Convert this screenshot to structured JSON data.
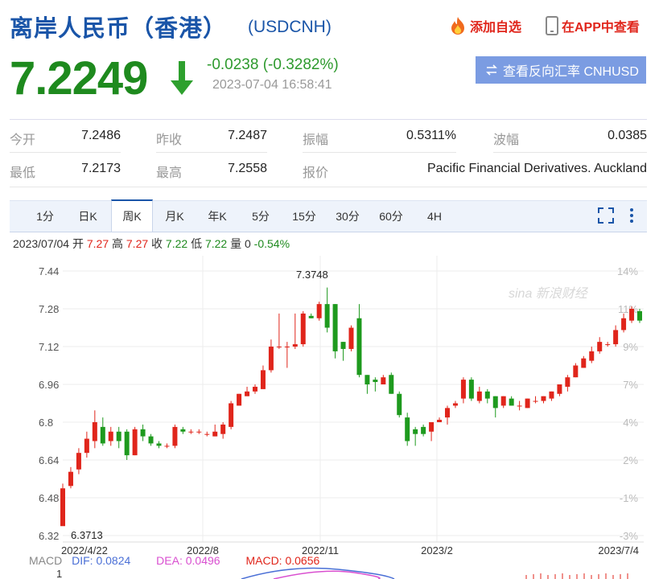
{
  "header": {
    "title": "离岸人民币（香港）",
    "code": "(USDCNH)",
    "add_watchlist": "添加自选",
    "view_in_app": "在APP中查看"
  },
  "quote": {
    "price": "7.2249",
    "change": "-0.0238 (-0.3282%)",
    "time": "2023-07-04 16:58:41",
    "reverse_button": "查看反向汇率 CNHUSD"
  },
  "stats": [
    [
      {
        "label": "今开",
        "value": "7.2486"
      },
      {
        "label": "昨收",
        "value": "7.2487"
      },
      {
        "label": "振幅",
        "value": "0.5311%"
      },
      {
        "label": "波幅",
        "value": "0.0385"
      }
    ],
    [
      {
        "label": "最低",
        "value": "7.2173"
      },
      {
        "label": "最高",
        "value": "7.2558"
      },
      {
        "label": "报价",
        "value": "Pacific Financial Derivatives. Auckland"
      }
    ]
  ],
  "tabs": [
    "1分",
    "日K",
    "周K",
    "月K",
    "年K",
    "5分",
    "15分",
    "30分",
    "60分",
    "4H"
  ],
  "active_tab": "周K",
  "ohlc_line": {
    "date": "2023/07/04",
    "open_label": "开",
    "open": "7.27",
    "high_label": "高",
    "high": "7.27",
    "close_label": "收",
    "close": "7.22",
    "low_label": "低",
    "low": "7.22",
    "vol_label": "量",
    "vol": "0",
    "pct": "-0.54%"
  },
  "chart_data": {
    "type": "candlestick",
    "y_ticks": [
      "7.44",
      "7.28",
      "7.12",
      "6.96",
      "6.8",
      "6.64",
      "6.48",
      "6.32"
    ],
    "right_ticks": [
      "14%",
      "11%",
      "9%",
      "7%",
      "4%",
      "2%",
      "-1%",
      "-3%"
    ],
    "x_ticks": [
      "2022/4/22",
      "2022/8",
      "2022/11",
      "2023/2",
      "2023/7/4"
    ],
    "ylim": [
      6.32,
      7.44
    ],
    "annotations": {
      "max_label": "7.3748",
      "min_label": "6.3713"
    },
    "watermark": "sina 新浪财经",
    "up_color": "#e0251b",
    "down_color": "#1e9a1e",
    "candles": [
      [
        6.36,
        6.52,
        6.37,
        6.54
      ],
      [
        6.53,
        6.59,
        6.52,
        6.61
      ],
      [
        6.6,
        6.67,
        6.58,
        6.69
      ],
      [
        6.67,
        6.73,
        6.65,
        6.76
      ],
      [
        6.72,
        6.8,
        6.69,
        6.85
      ],
      [
        6.78,
        6.71,
        6.7,
        6.82
      ],
      [
        6.72,
        6.76,
        6.7,
        6.78
      ],
      [
        6.76,
        6.72,
        6.69,
        6.78
      ],
      [
        6.76,
        6.66,
        6.64,
        6.77
      ],
      [
        6.66,
        6.77,
        6.66,
        6.78
      ],
      [
        6.77,
        6.74,
        6.72,
        6.79
      ],
      [
        6.74,
        6.71,
        6.7,
        6.75
      ],
      [
        6.71,
        6.7,
        6.69,
        6.72
      ],
      [
        6.7,
        6.7,
        6.69,
        6.71
      ],
      [
        6.7,
        6.78,
        6.69,
        6.79
      ],
      [
        6.77,
        6.76,
        6.75,
        6.78
      ],
      [
        6.76,
        6.76,
        6.75,
        6.77
      ],
      [
        6.76,
        6.76,
        6.75,
        6.77
      ],
      [
        6.75,
        6.75,
        6.74,
        6.76
      ],
      [
        6.74,
        6.76,
        6.74,
        6.79
      ],
      [
        6.75,
        6.79,
        6.73,
        6.8
      ],
      [
        6.78,
        6.88,
        6.77,
        6.89
      ],
      [
        6.87,
        6.92,
        6.87,
        6.92
      ],
      [
        6.91,
        6.93,
        6.91,
        6.95
      ],
      [
        6.93,
        6.95,
        6.92,
        6.96
      ],
      [
        6.94,
        7.02,
        6.94,
        7.04
      ],
      [
        7.02,
        7.12,
        7.01,
        7.15
      ],
      [
        7.12,
        7.12,
        7.11,
        7.26
      ],
      [
        7.12,
        7.12,
        7.03,
        7.14
      ],
      [
        7.12,
        7.13,
        7.11,
        7.26
      ],
      [
        7.13,
        7.26,
        7.12,
        7.27
      ],
      [
        7.25,
        7.24,
        7.24,
        7.26
      ],
      [
        7.24,
        7.3,
        7.23,
        7.31
      ],
      [
        7.3,
        7.2,
        7.18,
        7.37
      ],
      [
        7.3,
        7.1,
        7.07,
        7.3
      ],
      [
        7.14,
        7.11,
        7.06,
        7.14
      ],
      [
        7.11,
        7.2,
        7.1,
        7.21
      ],
      [
        7.24,
        7.0,
        6.99,
        7.3
      ],
      [
        7.0,
        6.96,
        6.92,
        7.0
      ],
      [
        6.98,
        6.97,
        6.93,
        6.99
      ],
      [
        6.96,
        6.99,
        6.96,
        7.0
      ],
      [
        7.0,
        6.92,
        6.92,
        7.01
      ],
      [
        6.92,
        6.83,
        6.82,
        6.93
      ],
      [
        6.82,
        6.72,
        6.7,
        6.84
      ],
      [
        6.77,
        6.75,
        6.7,
        6.78
      ],
      [
        6.78,
        6.75,
        6.74,
        6.79
      ],
      [
        6.76,
        6.8,
        6.72,
        6.8
      ],
      [
        6.8,
        6.81,
        6.8,
        6.82
      ],
      [
        6.82,
        6.86,
        6.79,
        6.87
      ],
      [
        6.87,
        6.88,
        6.86,
        6.89
      ],
      [
        6.9,
        6.98,
        6.88,
        6.99
      ],
      [
        6.98,
        6.9,
        6.89,
        6.99
      ],
      [
        6.89,
        6.93,
        6.88,
        6.95
      ],
      [
        6.93,
        6.9,
        6.88,
        6.94
      ],
      [
        6.91,
        6.86,
        6.82,
        6.91
      ],
      [
        6.87,
        6.91,
        6.86,
        6.91
      ],
      [
        6.9,
        6.87,
        6.87,
        6.91
      ],
      [
        6.87,
        6.87,
        6.85,
        6.89
      ],
      [
        6.86,
        6.9,
        6.86,
        6.9
      ],
      [
        6.89,
        6.89,
        6.88,
        6.91
      ],
      [
        6.89,
        6.91,
        6.88,
        6.91
      ],
      [
        6.9,
        6.93,
        6.89,
        6.93
      ],
      [
        6.92,
        6.96,
        6.91,
        6.96
      ],
      [
        6.95,
        6.99,
        6.93,
        7.0
      ],
      [
        6.99,
        7.04,
        6.99,
        7.05
      ],
      [
        7.03,
        7.07,
        7.03,
        7.08
      ],
      [
        7.06,
        7.1,
        7.05,
        7.12
      ],
      [
        7.1,
        7.14,
        7.09,
        7.16
      ],
      [
        7.13,
        7.13,
        7.12,
        7.14
      ],
      [
        7.13,
        7.19,
        7.12,
        7.21
      ],
      [
        7.19,
        7.24,
        7.18,
        7.26
      ],
      [
        7.23,
        7.28,
        7.22,
        7.29
      ],
      [
        7.27,
        7.23,
        7.22,
        7.28
      ]
    ]
  },
  "macd": {
    "label": "MACD",
    "dif": "DIF: 0.0824",
    "dea": "DEA: 0.0496",
    "macd": "MACD: 0.0656",
    "tick_top": "1",
    "colors": {
      "dif": "#4a6fd6",
      "dea": "#d94fd0",
      "macd": "#e0251b"
    }
  }
}
